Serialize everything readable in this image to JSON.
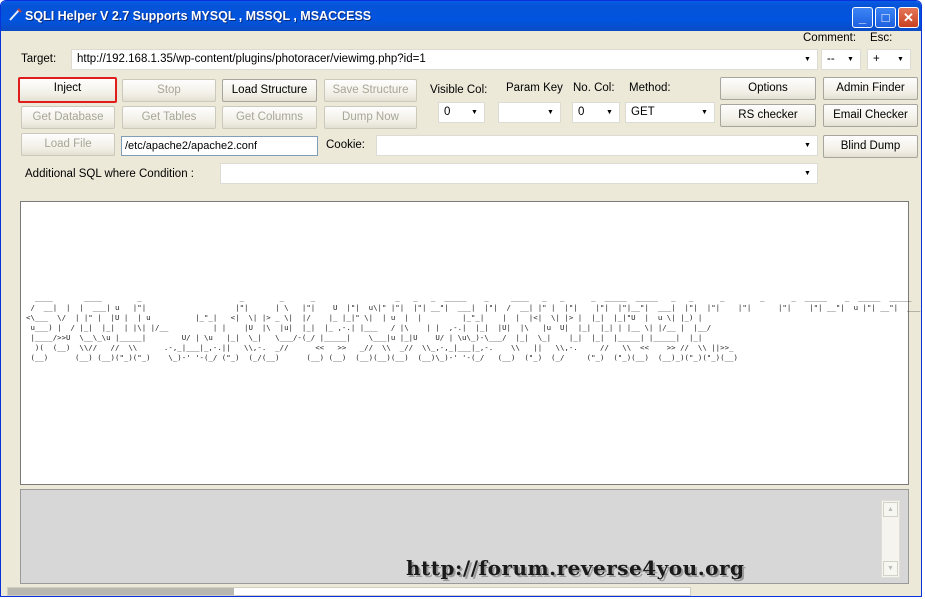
{
  "window": {
    "title": "SQLI Helper V 2.7 Supports MYSQL , MSSQL , MSACCESS",
    "buttons": {
      "minimize": "_",
      "maximize": "□",
      "close": "✕"
    }
  },
  "target": {
    "label": "Target:",
    "value": "http://192.168.1.35/wp-content/plugins/photoracer/viewimg.php?id=1"
  },
  "comment": {
    "label": "Comment:",
    "value": "--"
  },
  "esc": {
    "label": "Esc:",
    "value": "+"
  },
  "buttons": {
    "inject": "Inject",
    "stop": "Stop",
    "load_structure": "Load Structure",
    "save_structure": "Save Structure",
    "get_database": "Get Database",
    "get_tables": "Get Tables",
    "get_columns": "Get Columns",
    "dump_now": "Dump Now",
    "load_file": "Load File",
    "options": "Options",
    "admin_finder": "Admin Finder",
    "rs_checker": "RS checker",
    "email_checker": "Email Checker",
    "blind_dump": "Blind Dump"
  },
  "visible_col": {
    "label": "Visible Col:",
    "value": "0"
  },
  "param_key": {
    "label": "Param Key",
    "value": ""
  },
  "no_col": {
    "label": "No. Col:",
    "value": "0"
  },
  "method": {
    "label": "Method:",
    "value": "GET"
  },
  "load_file_path": {
    "value": "/etc/apache2/apache2.conf"
  },
  "cookie": {
    "label": "Cookie:",
    "value": ""
  },
  "additional_sql": {
    "label": "Additional SQL where Condition :",
    "value": ""
  },
  "banner_ascii": "  ____       ____        _                      _        _      _                  _   _   _  _____    _     ____   _   _      _  _____  _____   _   _      _        _      _  _____    _  _____  _____\n /  __|  |  |  ___| u   |\"|                    |\"|      | \\   |\"|    U  |\"|  u\\|\" |\"|  |\"| __\"|  ___|  |\"|  /  __| |\" |  |\"|    |\"|  |\"|__\"|  ___|  |\"|  |\"|    |\"|      |\"|    |\"| __\"|  u |\"| __\"|  ___| \\\n<\\___  \\/  | |\" |  |U |  | u          |_\"_|   <|  \\| |> _ \\|  |/    |_ |_|\" \\|  | u  |  |         |_\"_|    |  |  |<|  \\| |> |  |_|  |_|\"U  |  u \\| |_) |\n u___) |  / |_|  |_|  | |\\| |/__          | |    |U  |\\  |u|  |_|  |_ ,-.| |___   / |\\    | |  ,-.|  |_|  |U|  |\\   |u  U|  |_|  |_| | |__ \\| |/__ |  |__/\n |____/>>U  \\__\\_\\u |_____|        U/ | \\u   |_|  \\_|   \\___/-(_/ |_____|    \\___|u |_|U    U/ | \\u\\_)-\\___/  |_|  \\_|    |_|  |_|  |_____| |_____|  |_|\n  )(  (__)  \\\\//   //  \\\\      .-,_|___|_,-.||   \\\\,-.  _//      <<   >>   _//  \\\\  _//  \\\\_,-,_|___|_,-.    \\\\   ||   \\\\,-.     //   \\\\  <<    >> //  \\\\ ||>>_\n (__)      (__) (__)(\"_)(\"_)    \\_)-' '-(_/ (\"_)  (_/(__)      (__) (__)  (__)(__)(__)  (__)\\_)-' '-(_/   (__)  (\"_)  (_/     (\"_)  (\"_)(__)  (__)_)(\"_)(\"_)(__)",
  "watermark": "http://forum.reverse4you.org"
}
